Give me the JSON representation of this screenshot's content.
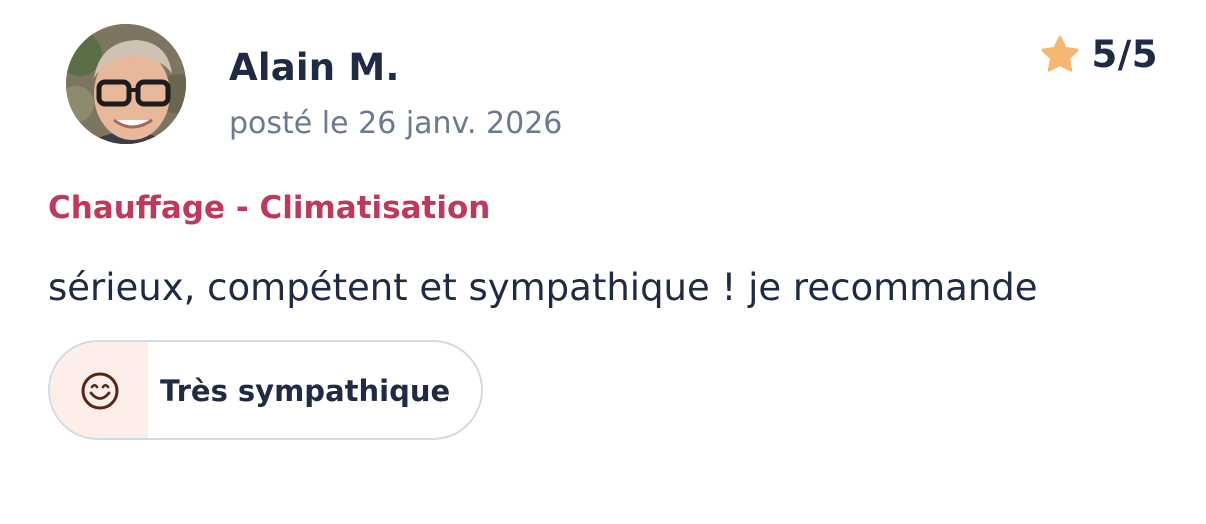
{
  "review": {
    "author": "Alain M.",
    "posted": "posté le 26 janv. 2026",
    "rating": "5/5",
    "category": "Chauffage - Climatisation",
    "comment": "sérieux, compétent et sympathique ! je recommande",
    "tag": {
      "label": "Très sympathique",
      "icon": "smiley-icon"
    }
  },
  "icons": {
    "rating": "star-icon",
    "avatar": "user-photo"
  },
  "colors": {
    "text": "#1f2a44",
    "muted": "#6b7a90",
    "category": "#c0385a",
    "star": "#f5b870",
    "chip_border": "#d3d9e4",
    "chip_icon_bg": "#fdeeea",
    "smiley": "#5a2614"
  }
}
